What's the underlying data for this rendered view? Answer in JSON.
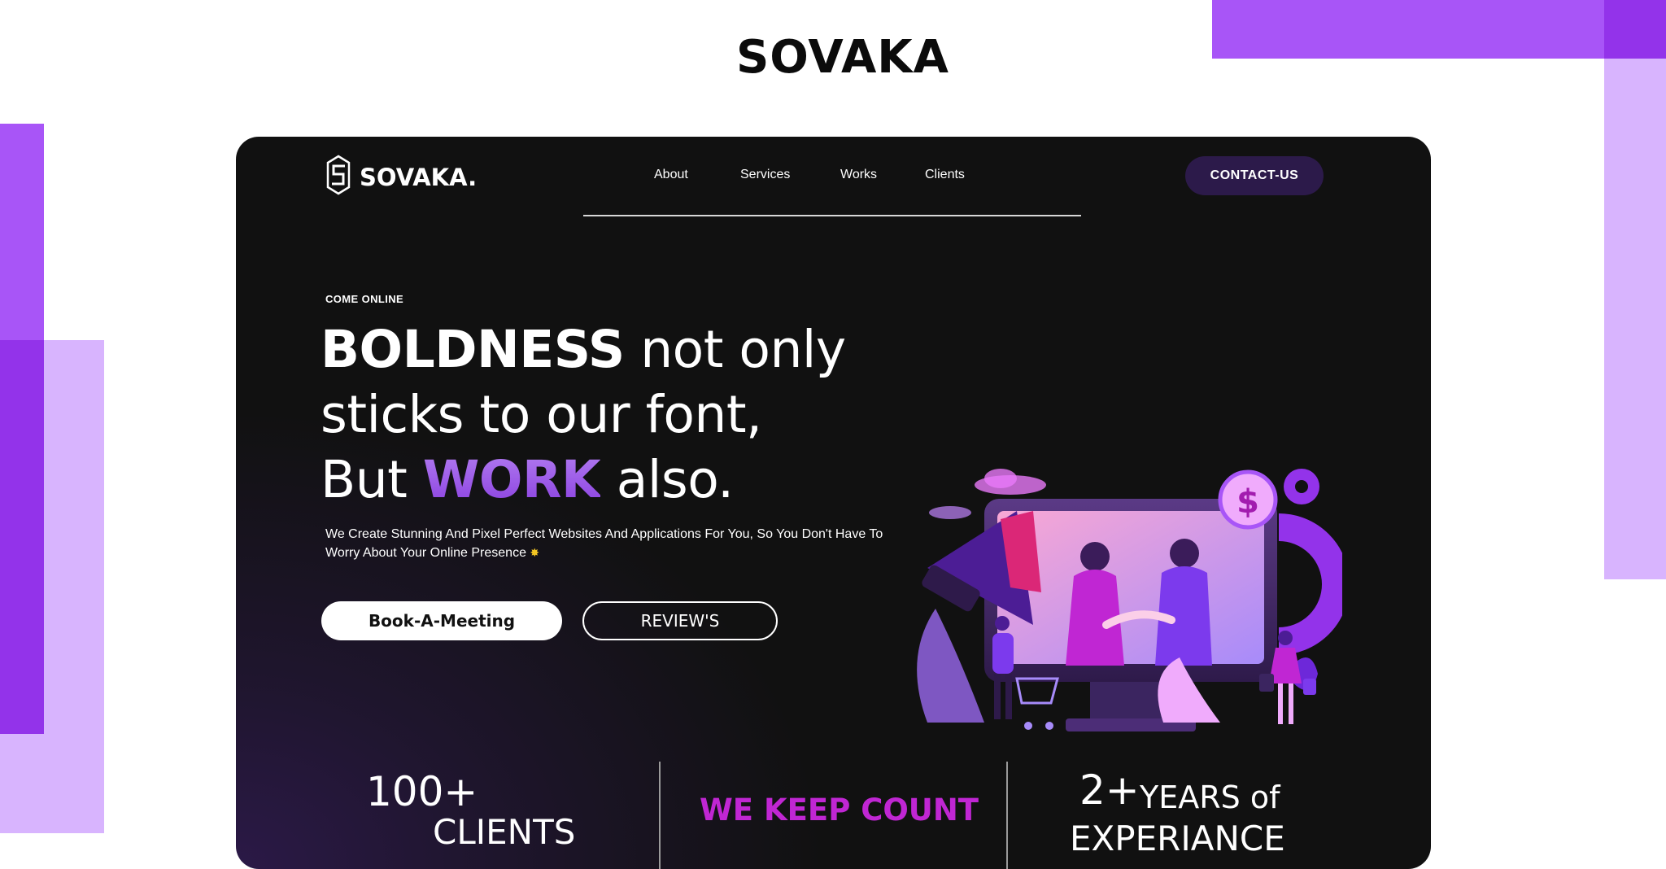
{
  "page": {
    "title": "SOVAKA"
  },
  "colors": {
    "accent_purple": "#a855f7",
    "light_purple": "#d8b4fe",
    "panel_bg": "#111111",
    "contact_bg": "#2c1a4a",
    "magenta": "#c026d3"
  },
  "brand": {
    "name": "SOVAKA.",
    "icon": "s-hexagon-logo-icon"
  },
  "nav": {
    "items": [
      "About",
      "Services",
      "Works",
      "Clients"
    ]
  },
  "header": {
    "contact_label": "CONTACT-US"
  },
  "hero": {
    "eyebrow": "COME ONLINE",
    "headline": {
      "strong": "BOLDNESS",
      "line1_rest": " not only",
      "line2": "sticks to our font,",
      "line3_start": "But ",
      "accent": "WORK",
      "line3_end": " also."
    },
    "subtext": "We Create Stunning And Pixel Perfect Websites And Applications For You, So You Don't Have To Worry About Your Online Presence",
    "subtext_icon": "sparkle-icon",
    "primary_button": "Book-A-Meeting",
    "secondary_button": "REVIEW'S"
  },
  "illustration": {
    "icon": "handshake-monitor-illustration"
  },
  "stats": {
    "clients_number": "100+",
    "clients_label": "CLIENTS",
    "tagline": "WE KEEP COUNT",
    "years_number": "2+",
    "years_label": "YEARS of",
    "years_label2": "EXPERIANCE"
  }
}
